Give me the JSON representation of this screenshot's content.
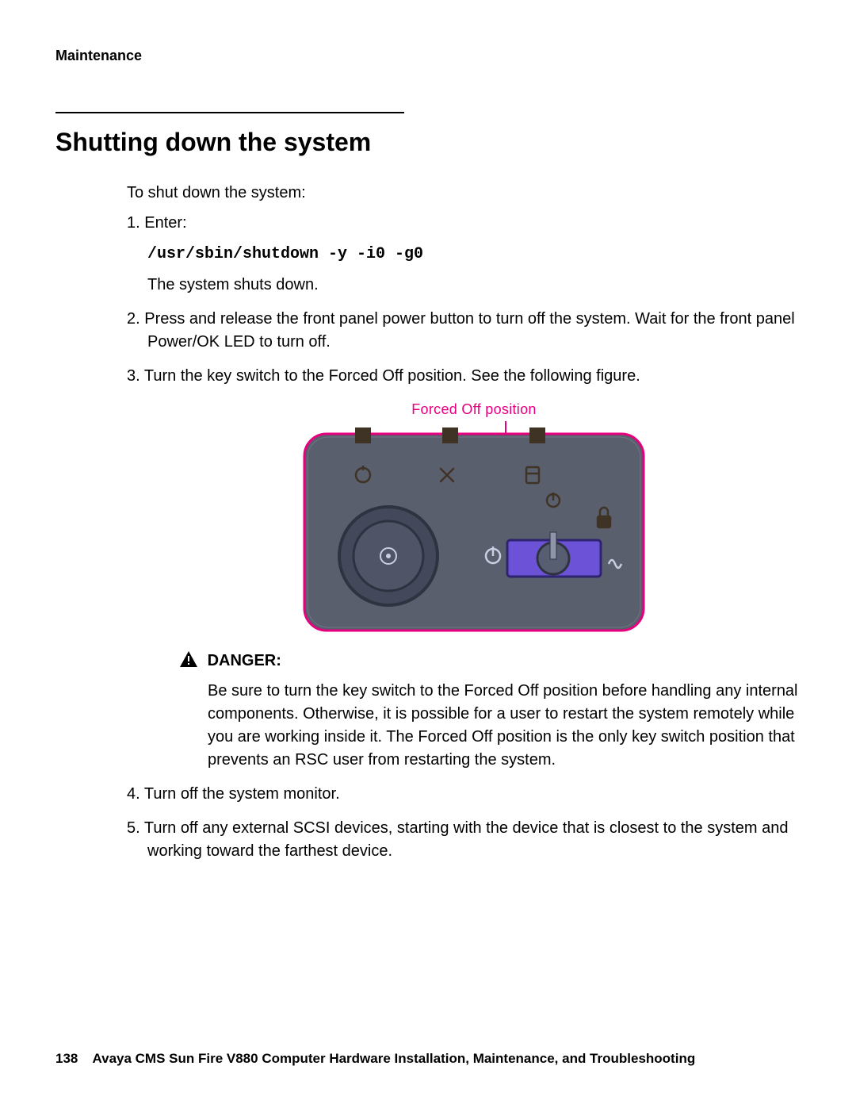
{
  "chapter": "Maintenance",
  "title": "Shutting down the system",
  "intro": "To shut down the system:",
  "steps": {
    "s1_label": "1. Enter:",
    "s1_cmd": "/usr/sbin/shutdown -y -i0 -g0",
    "s1_after": "The system shuts down.",
    "s2": "2. Press and release the front panel power button to turn off the system. Wait for the front panel Power/OK LED to turn off.",
    "s3": "3. Turn the key switch to the Forced Off position. See the following figure.",
    "fig_caption": "Forced Off position",
    "danger_label": "DANGER:",
    "danger_body": "Be sure to turn the key switch to the Forced Off position before handling any internal components. Otherwise, it is possible for a user to restart the system remotely while you are working inside it. The Forced Off position is the only key switch position that prevents an RSC user from restarting the system.",
    "s4": "4. Turn off the system monitor.",
    "s5": "5. Turn off any external SCSI devices, starting with the device that is closest to the system and working toward the farthest device."
  },
  "footer": {
    "page_number": "138",
    "book_title": "Avaya CMS Sun Fire V880 Computer Hardware Installation, Maintenance, and Troubleshooting"
  }
}
